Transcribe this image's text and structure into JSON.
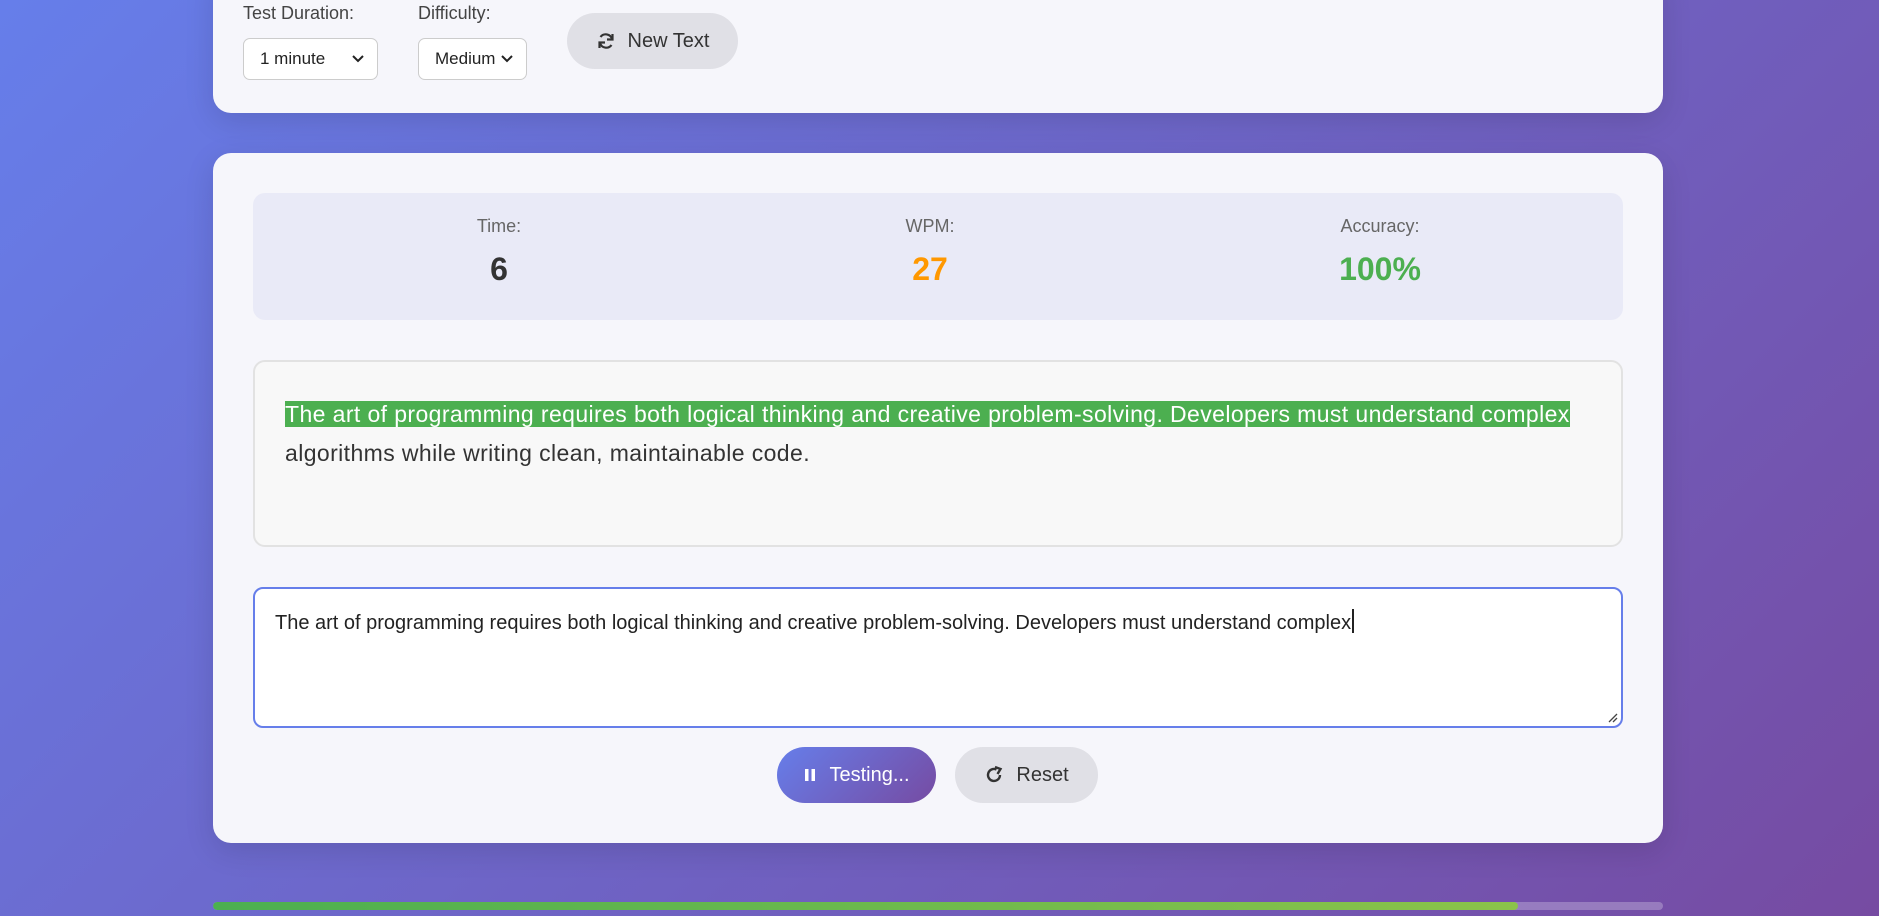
{
  "settings": {
    "duration_label": "Test Duration:",
    "duration_value": "1 minute",
    "difficulty_label": "Difficulty:",
    "difficulty_value": "Medium",
    "new_text_label": "New Text"
  },
  "stats": {
    "time_label": "Time:",
    "time_value": "6",
    "wpm_label": "WPM:",
    "wpm_value": "27",
    "accuracy_label": "Accuracy:",
    "accuracy_value": "100%"
  },
  "passage": {
    "typed_text": "The art of programming requires both logical thinking and creative problem-solving. Developers must understand complex",
    "current_char": " ",
    "remaining_text": "algorithms while writing clean, maintainable code."
  },
  "input": {
    "value": "The art of programming requires both logical thinking and creative problem-solving. Developers must understand complex"
  },
  "controls": {
    "testing_label": "Testing...",
    "reset_label": "Reset"
  },
  "progress": {
    "fraction": 0.9
  },
  "colors": {
    "accent": "#667eea",
    "accent_secondary": "#764ba2",
    "correct": "#4caf50",
    "wpm": "#ff9800",
    "accuracy": "#4caf50"
  },
  "icons": {
    "new_text": "refresh-icon",
    "testing": "pause-icon",
    "reset": "redo-icon",
    "select": "chevron-down-icon"
  }
}
